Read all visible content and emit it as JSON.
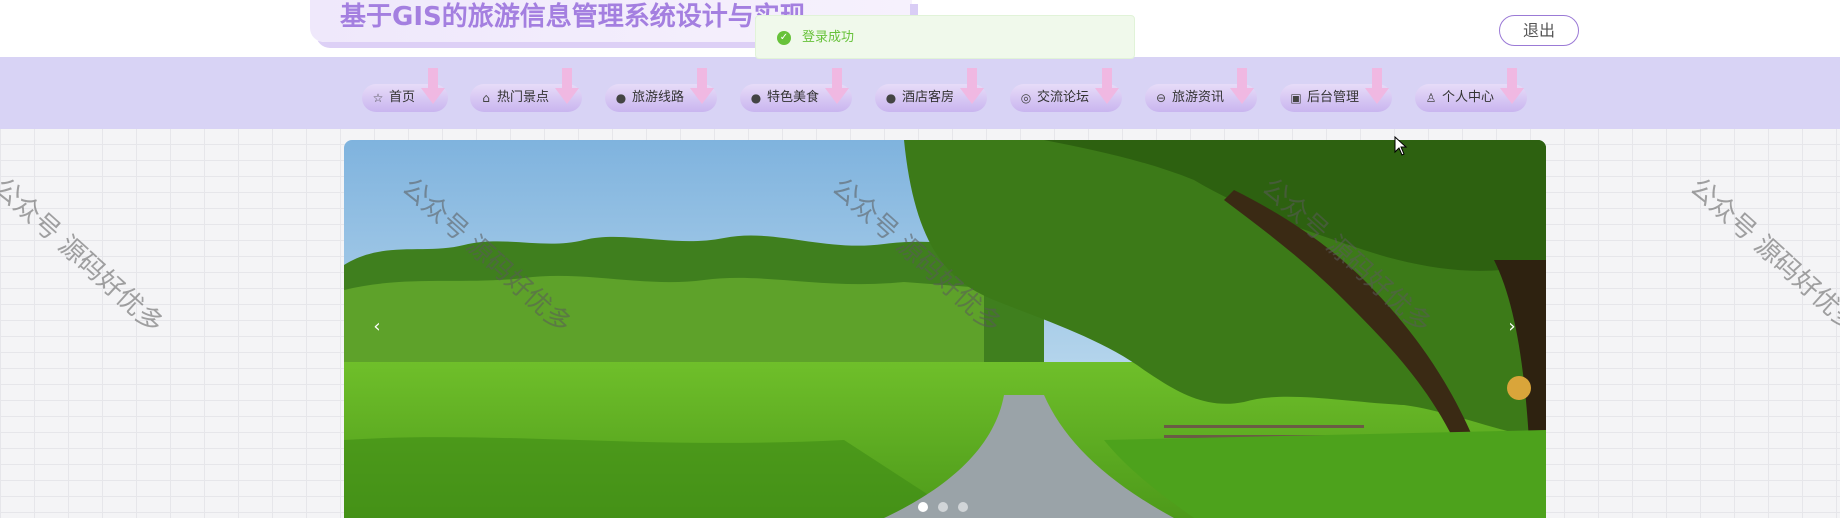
{
  "header": {
    "site_title": "基于GIS的旅游信息管理系统设计与实现",
    "logout_label": "退出"
  },
  "toast": {
    "message": "登录成功",
    "icon": "check-circle-icon",
    "color": "#67c23a"
  },
  "nav": {
    "items": [
      {
        "label": "首页",
        "icon": "star-icon"
      },
      {
        "label": "热门景点",
        "icon": "bag-icon"
      },
      {
        "label": "旅游线路",
        "icon": "info-circle-icon"
      },
      {
        "label": "特色美食",
        "icon": "question-circle-icon"
      },
      {
        "label": "酒店客房",
        "icon": "info-circle-icon"
      },
      {
        "label": "交流论坛",
        "icon": "at-circle-icon"
      },
      {
        "label": "旅游资讯",
        "icon": "minus-circle-icon"
      },
      {
        "label": "后台管理",
        "icon": "briefcase-icon"
      },
      {
        "label": "个人中心",
        "icon": "user-icon"
      }
    ]
  },
  "carousel": {
    "prev_icon": "chevron-left-icon",
    "next_icon": "chevron-right-icon",
    "slide_count": 3,
    "active_index": 0,
    "prev_glyph": "‹",
    "next_glyph": "›"
  },
  "watermark": {
    "text": "公众号 源码好优多"
  },
  "colors": {
    "accent": "#a47fe0",
    "nav_bg": "#d8d3f5",
    "toast_bg": "#f0f9eb"
  }
}
